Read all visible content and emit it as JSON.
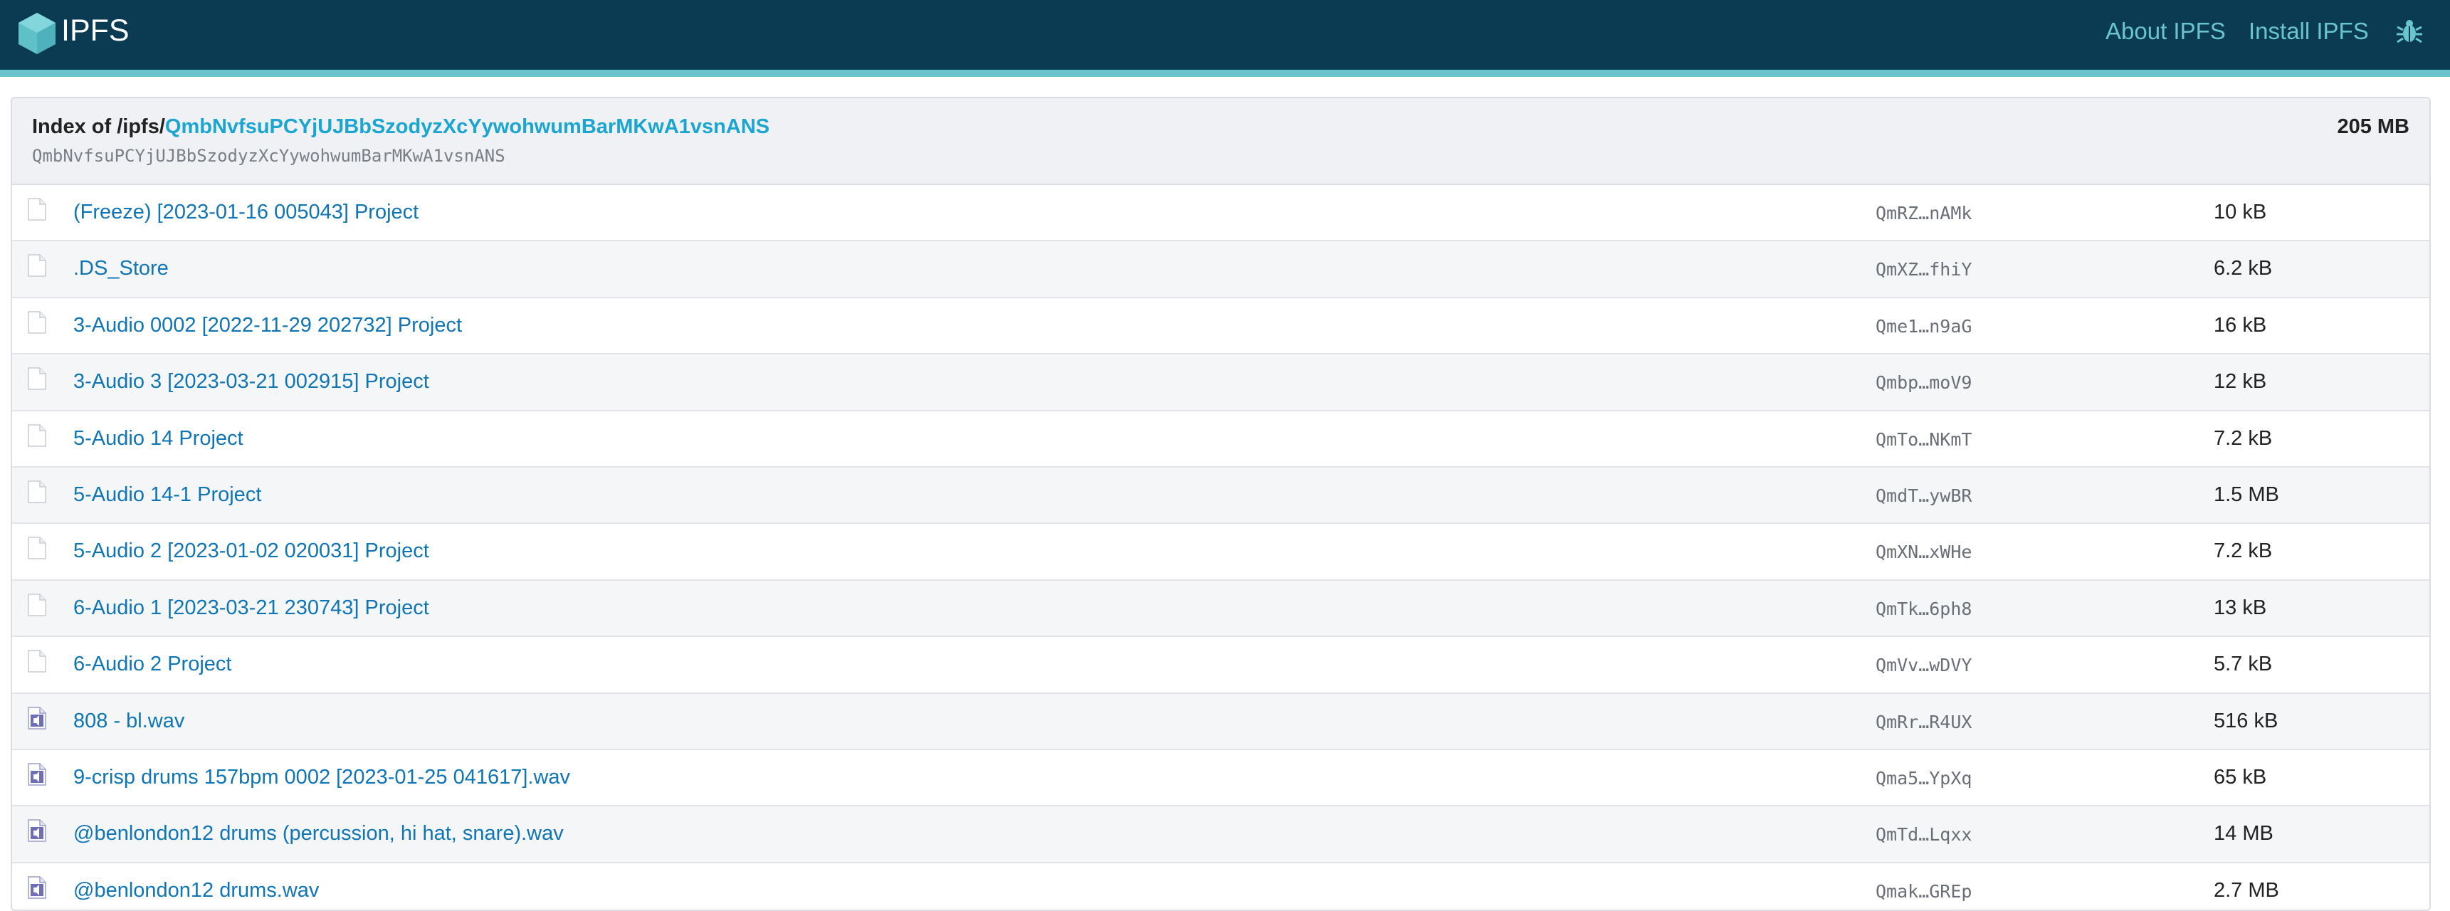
{
  "header": {
    "brand": "IPFS",
    "nav": [
      {
        "label": "About IPFS"
      },
      {
        "label": "Install IPFS"
      }
    ],
    "colors": {
      "bar": "#0b3a53",
      "accent": "#69c4cd"
    }
  },
  "index": {
    "prefix": "Index of /ipfs/",
    "cid_link": "QmbNvfsuPCYjUJBbSzodyzXcYywohwumBarMKwA1vsnANS",
    "cid_full": "QmbNvfsuPCYjUJBbSzodyzXcYywohwumBarMKwA1vsnANS",
    "total_size": "205 MB"
  },
  "files": [
    {
      "name": "(Freeze) [2023-01-16 005043] Project",
      "hash": "QmRZ…nAMk",
      "size": "10 kB",
      "icon": "file-icon"
    },
    {
      "name": ".DS_Store",
      "hash": "QmXZ…fhiY",
      "size": "6.2 kB",
      "icon": "file-icon"
    },
    {
      "name": "3-Audio 0002 [2022-11-29 202732] Project",
      "hash": "Qme1…n9aG",
      "size": "16 kB",
      "icon": "file-icon"
    },
    {
      "name": "3-Audio 3 [2023-03-21 002915] Project",
      "hash": "Qmbp…moV9",
      "size": "12 kB",
      "icon": "file-icon"
    },
    {
      "name": "5-Audio 14 Project",
      "hash": "QmTo…NKmT",
      "size": "7.2 kB",
      "icon": "file-icon"
    },
    {
      "name": "5-Audio 14-1 Project",
      "hash": "QmdT…ywBR",
      "size": "1.5 MB",
      "icon": "file-icon"
    },
    {
      "name": "5-Audio 2 [2023-01-02 020031] Project",
      "hash": "QmXN…xWHe",
      "size": "7.2 kB",
      "icon": "file-icon"
    },
    {
      "name": "6-Audio 1 [2023-03-21 230743] Project",
      "hash": "QmTk…6ph8",
      "size": "13 kB",
      "icon": "file-icon"
    },
    {
      "name": "6-Audio 2 Project",
      "hash": "QmVv…wDVY",
      "size": "5.7 kB",
      "icon": "file-icon"
    },
    {
      "name": "808 - bl.wav",
      "hash": "QmRr…R4UX",
      "size": "516 kB",
      "icon": "audio-file-icon"
    },
    {
      "name": "9-crisp drums 157bpm 0002 [2023-01-25 041617].wav",
      "hash": "Qma5…YpXq",
      "size": "65 kB",
      "icon": "audio-file-icon"
    },
    {
      "name": "@benlondon12 drums (percussion, hi hat, snare).wav",
      "hash": "QmTd…Lqxx",
      "size": "14 MB",
      "icon": "audio-file-icon"
    },
    {
      "name": "@benlondon12 drums.wav",
      "hash": "Qmak…GREp",
      "size": "2.7 MB",
      "icon": "audio-file-icon"
    }
  ]
}
